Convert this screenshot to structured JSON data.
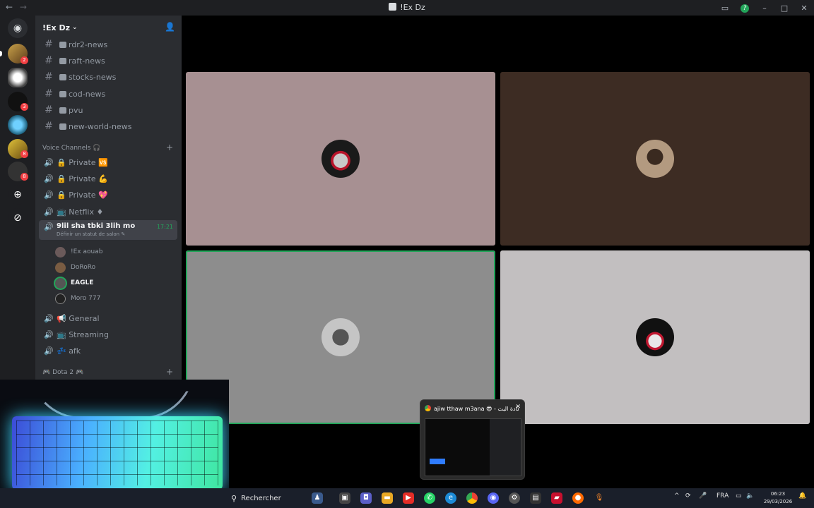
{
  "window": {
    "title": "!Ex Dz",
    "back_icon": "←",
    "forward_icon": "→",
    "controls": {
      "inbox": "▭",
      "help": "?",
      "minimize": "–",
      "maximize": "□",
      "close": "✕"
    }
  },
  "server": {
    "name": "!Ex Dz",
    "badges": [
      "2",
      "3",
      "8",
      "8"
    ]
  },
  "text_channels": [
    "rdr2-news",
    "raft-news",
    "stocks-news",
    "cod-news",
    "pvu",
    "new-world-news"
  ],
  "voice_category": "Voice Channels 🎧",
  "voice_channels": [
    {
      "name": "🔒 Private 🆚"
    },
    {
      "name": "🔒 Private 💪"
    },
    {
      "name": "🔒 Private 💖"
    },
    {
      "name": "📺 Netflix ♦"
    }
  ],
  "active_channel": {
    "name": "9lil sha tbki 3lih mo",
    "timer": "17:21",
    "status": "Définir un statut de salon ✎"
  },
  "voice_users": [
    "!Ex aouab",
    "DoRoRo",
    "EAGLE",
    "Moro 777"
  ],
  "more_channels": [
    "📢 General",
    "📺 Streaming",
    "💤 afk"
  ],
  "dota_category": "🎮 Dota 2 🎮",
  "tiles": [
    {
      "bg": "#a79092",
      "speaking": false
    },
    {
      "bg": "#3d2c23",
      "speaking": false
    },
    {
      "bg": "#8d8d8d",
      "speaking": true
    },
    {
      "bg": "#c2bfc0",
      "speaking": false
    }
  ],
  "preview": {
    "title": "ajiw tthaw m3ana 😎 - إعادة البث ...",
    "close": "✕"
  },
  "taskbar": {
    "search_placeholder": "Rechercher",
    "language": "FRA",
    "time": "06:23",
    "date": "29/03/2026"
  },
  "colors": {
    "accent_green": "#23a55a",
    "sidebar": "#2b2d31",
    "rail": "#1e1f22"
  }
}
